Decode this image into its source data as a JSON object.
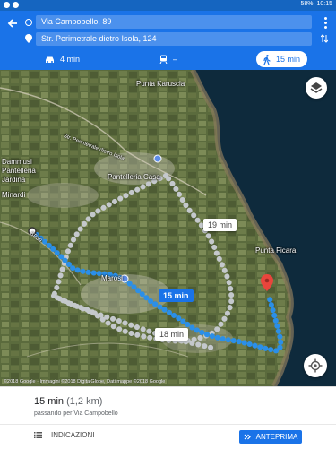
{
  "statusbar": {
    "battery": "58%",
    "time": "10:15"
  },
  "header": {
    "origin": "Via Campobello, 89",
    "destination": "Str. Perimetrale dietro Isola, 124"
  },
  "modes": [
    {
      "icon": "car-icon",
      "label": "4 min"
    },
    {
      "icon": "train-icon",
      "label": "–"
    },
    {
      "icon": "walk-icon",
      "label": "15 min"
    }
  ],
  "map": {
    "places": [
      "Punta Karuscia",
      "Str. Perimetrale dietro Isola",
      "Dammusi Pantelleria Jardina",
      "Pantelleria Casa",
      "Minardi",
      "Punta Ficara",
      "Marosi",
      "SP39"
    ],
    "route_times": {
      "alt1": "19 min",
      "main": "15 min",
      "alt2": "18 min"
    },
    "copyright": "©2018 Google · Immagini ©2018 DigitalGlobe, Dati mappe ©2018 Google"
  },
  "summary": {
    "duration": "15 min",
    "distance": "(1,2 km)",
    "via": "passando per Via Campobello",
    "steps_label": "INDICAZIONI",
    "preview_label": "ANTEPRIMA"
  }
}
